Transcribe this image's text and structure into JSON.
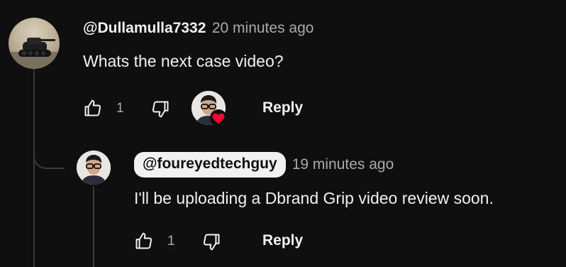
{
  "comment": {
    "author": "@Dullamulla7332",
    "time": "20 minutes ago",
    "text": "Whats the next case video?",
    "like_count": "1",
    "reply_label": "Reply",
    "avatar_icon": "tank-avatar",
    "hearted_by_icon": "creator-avatar-heart-icon"
  },
  "reply": {
    "author": "@foureyedtechguy",
    "time": "19 minutes ago",
    "text": "I'll be uploading a Dbrand Grip video review soon.",
    "like_count": "1",
    "reply_label": "Reply",
    "avatar_icon": "creator-avatar"
  },
  "colors": {
    "background": "#0f0f0f",
    "text": "#f1f1f1",
    "secondary": "#aaaaaa",
    "heart": "#ff0033"
  }
}
